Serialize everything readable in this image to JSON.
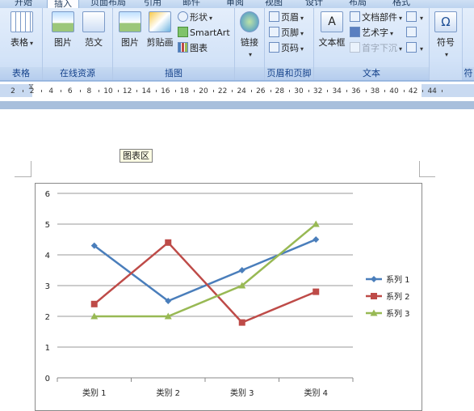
{
  "tabs": [
    "开始",
    "插入",
    "页面布局",
    "引用",
    "邮件",
    "审阅",
    "视图",
    "设计",
    "布局",
    "格式"
  ],
  "active_tab": "插入",
  "groups": {
    "table": {
      "title": "表格",
      "button": "表格"
    },
    "online": {
      "title": "在线资源",
      "pic": "图片",
      "fan": "范文"
    },
    "illustrations": {
      "title": "插图",
      "picture": "图片",
      "clipart": "剪贴画",
      "shapes": "形状",
      "smartart": "SmartArt",
      "chart": "图表"
    },
    "links": {
      "title": "",
      "button": "链接"
    },
    "header_footer": {
      "title": "页眉和页脚",
      "header": "页眉",
      "footer": "页脚",
      "page_number": "页码"
    },
    "text": {
      "title": "文本",
      "textbox": "文本框",
      "doc_parts": "文档部件",
      "wordart": "艺术字",
      "drop_cap": "首字下沉"
    },
    "symbols": {
      "title": "符",
      "button": "符号"
    }
  },
  "ruler": {
    "labels": [
      "2",
      "2",
      "4",
      "6",
      "8",
      "10",
      "12",
      "14",
      "16",
      "18",
      "20",
      "22",
      "24",
      "26",
      "28",
      "30",
      "32",
      "34",
      "36",
      "38",
      "40",
      "42",
      "44"
    ]
  },
  "tooltip": "图表区",
  "chart_data": {
    "type": "line",
    "categories": [
      "类别 1",
      "类别 2",
      "类别 3",
      "类别 4"
    ],
    "series": [
      {
        "name": "系列 1",
        "values": [
          4.3,
          2.5,
          3.5,
          4.5
        ],
        "color": "#4a7ebb",
        "marker": "diamond"
      },
      {
        "name": "系列 2",
        "values": [
          2.4,
          4.4,
          1.8,
          2.8
        ],
        "color": "#be4b48",
        "marker": "square"
      },
      {
        "name": "系列 3",
        "values": [
          2.0,
          2.0,
          3.0,
          5.0
        ],
        "color": "#98b954",
        "marker": "triangle"
      }
    ],
    "ylim": [
      0,
      6
    ],
    "yticks": [
      0,
      1,
      2,
      3,
      4,
      5,
      6
    ],
    "grid": true,
    "legend": "right"
  }
}
